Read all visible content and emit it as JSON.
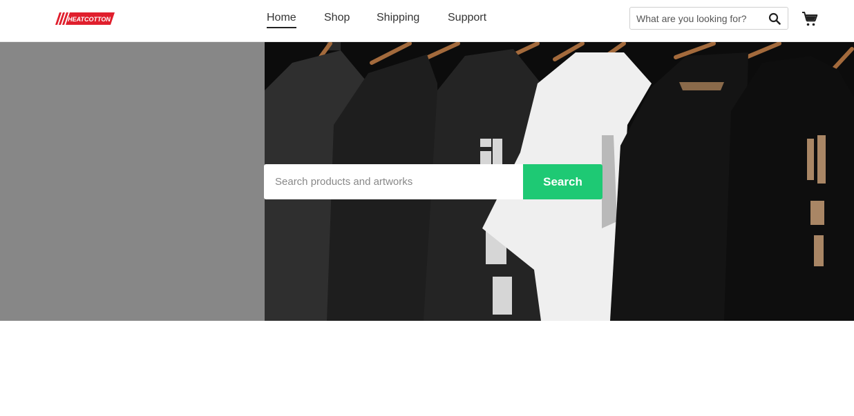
{
  "brand": {
    "name": "HEATCOTTON",
    "accent_color": "#e01f2d"
  },
  "nav": {
    "items": [
      {
        "label": "Home",
        "active": true
      },
      {
        "label": "Shop",
        "active": false
      },
      {
        "label": "Shipping",
        "active": false
      },
      {
        "label": "Support",
        "active": false
      }
    ]
  },
  "header_search": {
    "placeholder": "What are you looking for?",
    "icon": "search-icon"
  },
  "cart": {
    "icon": "cart-icon"
  },
  "hero": {
    "image": "t-shirts-on-hangers",
    "search": {
      "placeholder": "Search products and artworks",
      "button_label": "Search",
      "button_color": "#1ec974"
    }
  }
}
